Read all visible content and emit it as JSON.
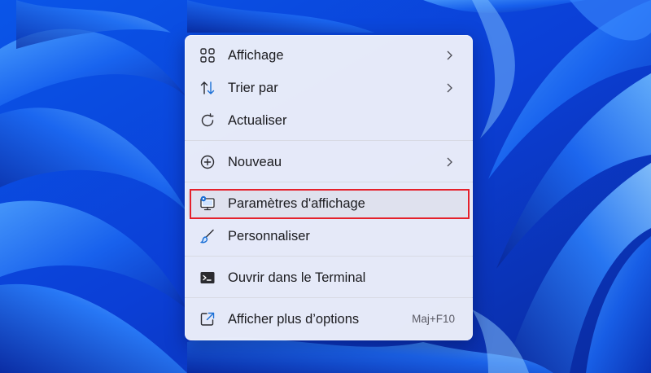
{
  "menu": {
    "items": [
      {
        "label": "Affichage",
        "icon": "grid-icon",
        "submenu": true
      },
      {
        "label": "Trier par",
        "icon": "sort-arrows-icon",
        "submenu": true
      },
      {
        "label": "Actualiser",
        "icon": "refresh-icon",
        "submenu": false
      },
      {
        "label": "Nouveau",
        "icon": "plus-circle-icon",
        "submenu": true
      },
      {
        "label": "Paramètres d'affichage",
        "icon": "display-settings-icon",
        "submenu": false,
        "highlighted": true
      },
      {
        "label": "Personnaliser",
        "icon": "paintbrush-icon",
        "submenu": false
      },
      {
        "label": "Ouvrir dans le Terminal",
        "icon": "terminal-icon",
        "submenu": false
      },
      {
        "label": "Afficher plus d’options",
        "icon": "open-external-icon",
        "submenu": false,
        "shortcut": "Maj+F10"
      }
    ]
  },
  "colors": {
    "highlight_border": "#e5202a",
    "wallpaper_blue": "#0b3fd6",
    "menu_background": "#eef0fa",
    "accent_icon": "#1a6fd6"
  }
}
